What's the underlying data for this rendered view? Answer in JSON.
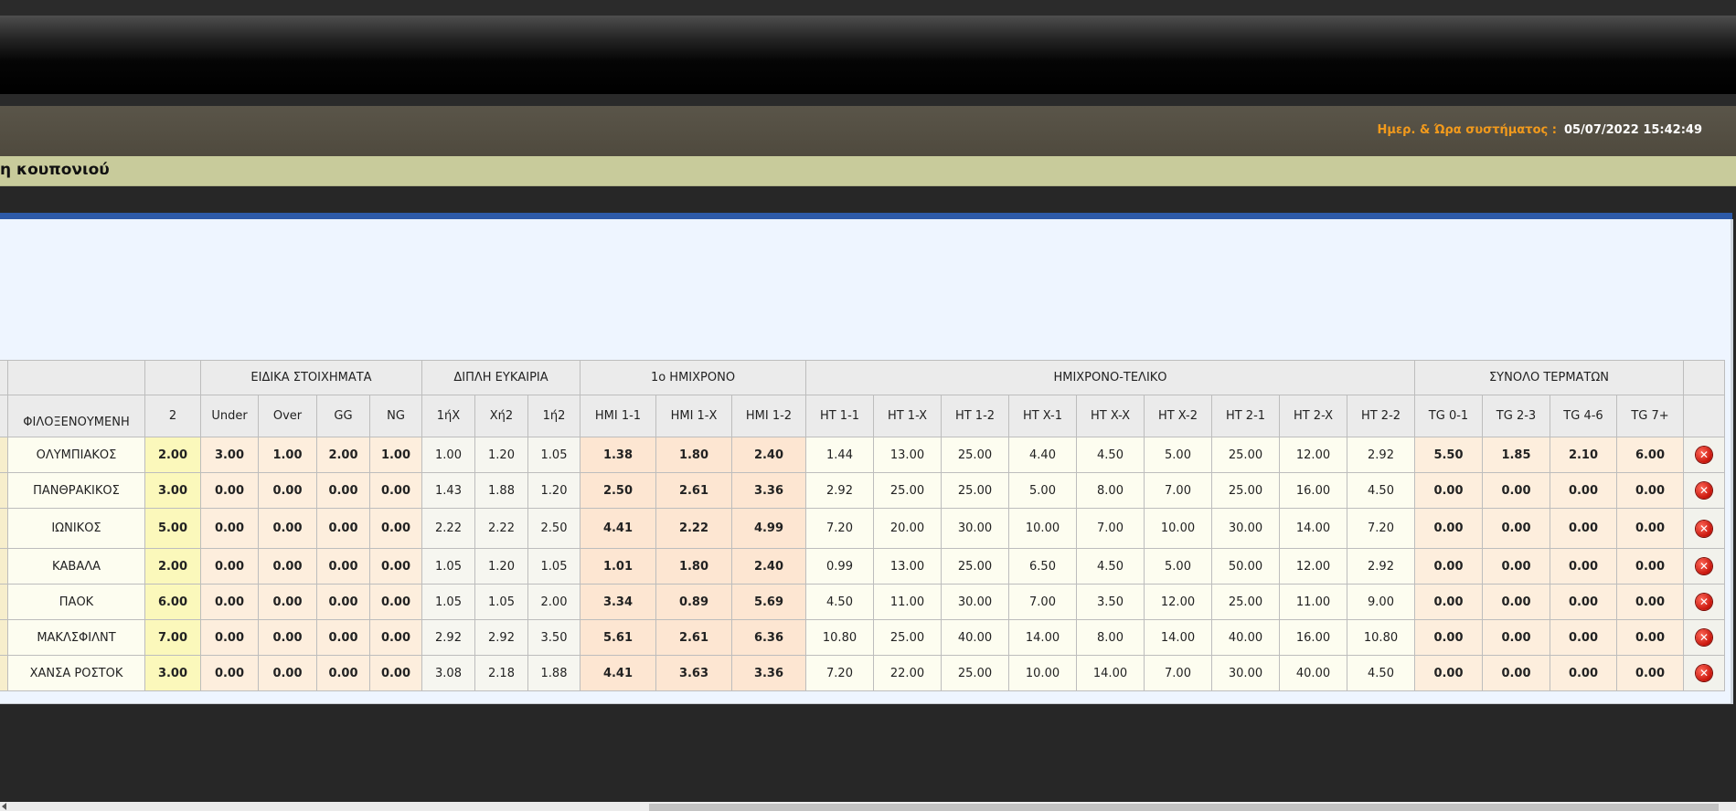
{
  "system_time": {
    "label": "Ημερ. & Ώρα συστήματος :",
    "value": "05/07/2022 15:42:49"
  },
  "page_title": "η κουπονιού",
  "table": {
    "group_headers": [
      "ΕΙΔΙΚΑ ΣΤΟΙΧΗΜΑΤΑ",
      "ΔΙΠΛΗ ΕΥΚΑΙΡΙΑ",
      "1ο ΗΜΙΧΡΟΝΟ",
      "ΗΜΙΧΡΟΝΟ-ΤΕΛΙΚΟ",
      "ΣΥΝΟΛΟ ΤΕΡΜΑΤΩΝ"
    ],
    "columns": [
      "ΦΙΛΟΞΕΝΟΥΜΕΝΗ",
      "2",
      "Under",
      "Over",
      "GG",
      "NG",
      "1ήΧ",
      "Χή2",
      "1ή2",
      "ΗΜΙ 1-1",
      "ΗΜΙ 1-Χ",
      "ΗΜΙ 1-2",
      "HT 1-1",
      "HT 1-X",
      "HT 1-2",
      "HT X-1",
      "HT X-X",
      "HT X-2",
      "HT 2-1",
      "HT 2-X",
      "HT 2-2",
      "TG 0-1",
      "TG 2-3",
      "TG 4-6",
      "TG 7+"
    ],
    "rows": [
      [
        "ΟΛΥΜΠΙΑΚΟΣ",
        "2.00",
        "3.00",
        "1.00",
        "2.00",
        "1.00",
        "1.00",
        "1.20",
        "1.05",
        "1.38",
        "1.80",
        "2.40",
        "1.44",
        "13.00",
        "25.00",
        "4.40",
        "4.50",
        "5.00",
        "25.00",
        "12.00",
        "2.92",
        "5.50",
        "1.85",
        "2.10",
        "6.00"
      ],
      [
        "ΠΑΝΘΡΑΚΙΚΟΣ",
        "3.00",
        "0.00",
        "0.00",
        "0.00",
        "0.00",
        "1.43",
        "1.88",
        "1.20",
        "2.50",
        "2.61",
        "3.36",
        "2.92",
        "25.00",
        "25.00",
        "5.00",
        "8.00",
        "7.00",
        "25.00",
        "16.00",
        "4.50",
        "0.00",
        "0.00",
        "0.00",
        "0.00"
      ],
      [
        "ΙΩΝΙΚΟΣ",
        "5.00",
        "0.00",
        "0.00",
        "0.00",
        "0.00",
        "2.22",
        "2.22",
        "2.50",
        "4.41",
        "2.22",
        "4.99",
        "7.20",
        "20.00",
        "30.00",
        "10.00",
        "7.00",
        "10.00",
        "30.00",
        "14.00",
        "7.20",
        "0.00",
        "0.00",
        "0.00",
        "0.00"
      ],
      [
        "ΚΑΒΑΛΑ",
        "2.00",
        "0.00",
        "0.00",
        "0.00",
        "0.00",
        "1.05",
        "1.20",
        "1.05",
        "1.01",
        "1.80",
        "2.40",
        "0.99",
        "13.00",
        "25.00",
        "6.50",
        "4.50",
        "5.00",
        "50.00",
        "12.00",
        "2.92",
        "0.00",
        "0.00",
        "0.00",
        "0.00"
      ],
      [
        "ΠΑΟΚ",
        "6.00",
        "0.00",
        "0.00",
        "0.00",
        "0.00",
        "1.05",
        "1.05",
        "2.00",
        "3.34",
        "0.89",
        "5.69",
        "4.50",
        "11.00",
        "30.00",
        "7.00",
        "3.50",
        "12.00",
        "25.00",
        "11.00",
        "9.00",
        "0.00",
        "0.00",
        "0.00",
        "0.00"
      ],
      [
        "ΜΑΚΛΣΦΙΛΝΤ",
        "7.00",
        "0.00",
        "0.00",
        "0.00",
        "0.00",
        "2.92",
        "2.92",
        "3.50",
        "5.61",
        "2.61",
        "6.36",
        "10.80",
        "25.00",
        "40.00",
        "14.00",
        "8.00",
        "14.00",
        "40.00",
        "16.00",
        "10.80",
        "0.00",
        "0.00",
        "0.00",
        "0.00"
      ],
      [
        "ΧΑΝΣΑ ΡΟΣΤΟΚ",
        "3.00",
        "0.00",
        "0.00",
        "0.00",
        "0.00",
        "3.08",
        "2.18",
        "1.88",
        "4.41",
        "3.63",
        "3.36",
        "7.20",
        "22.00",
        "25.00",
        "10.00",
        "14.00",
        "7.00",
        "30.00",
        "40.00",
        "4.50",
        "0.00",
        "0.00",
        "0.00",
        "0.00"
      ]
    ]
  }
}
